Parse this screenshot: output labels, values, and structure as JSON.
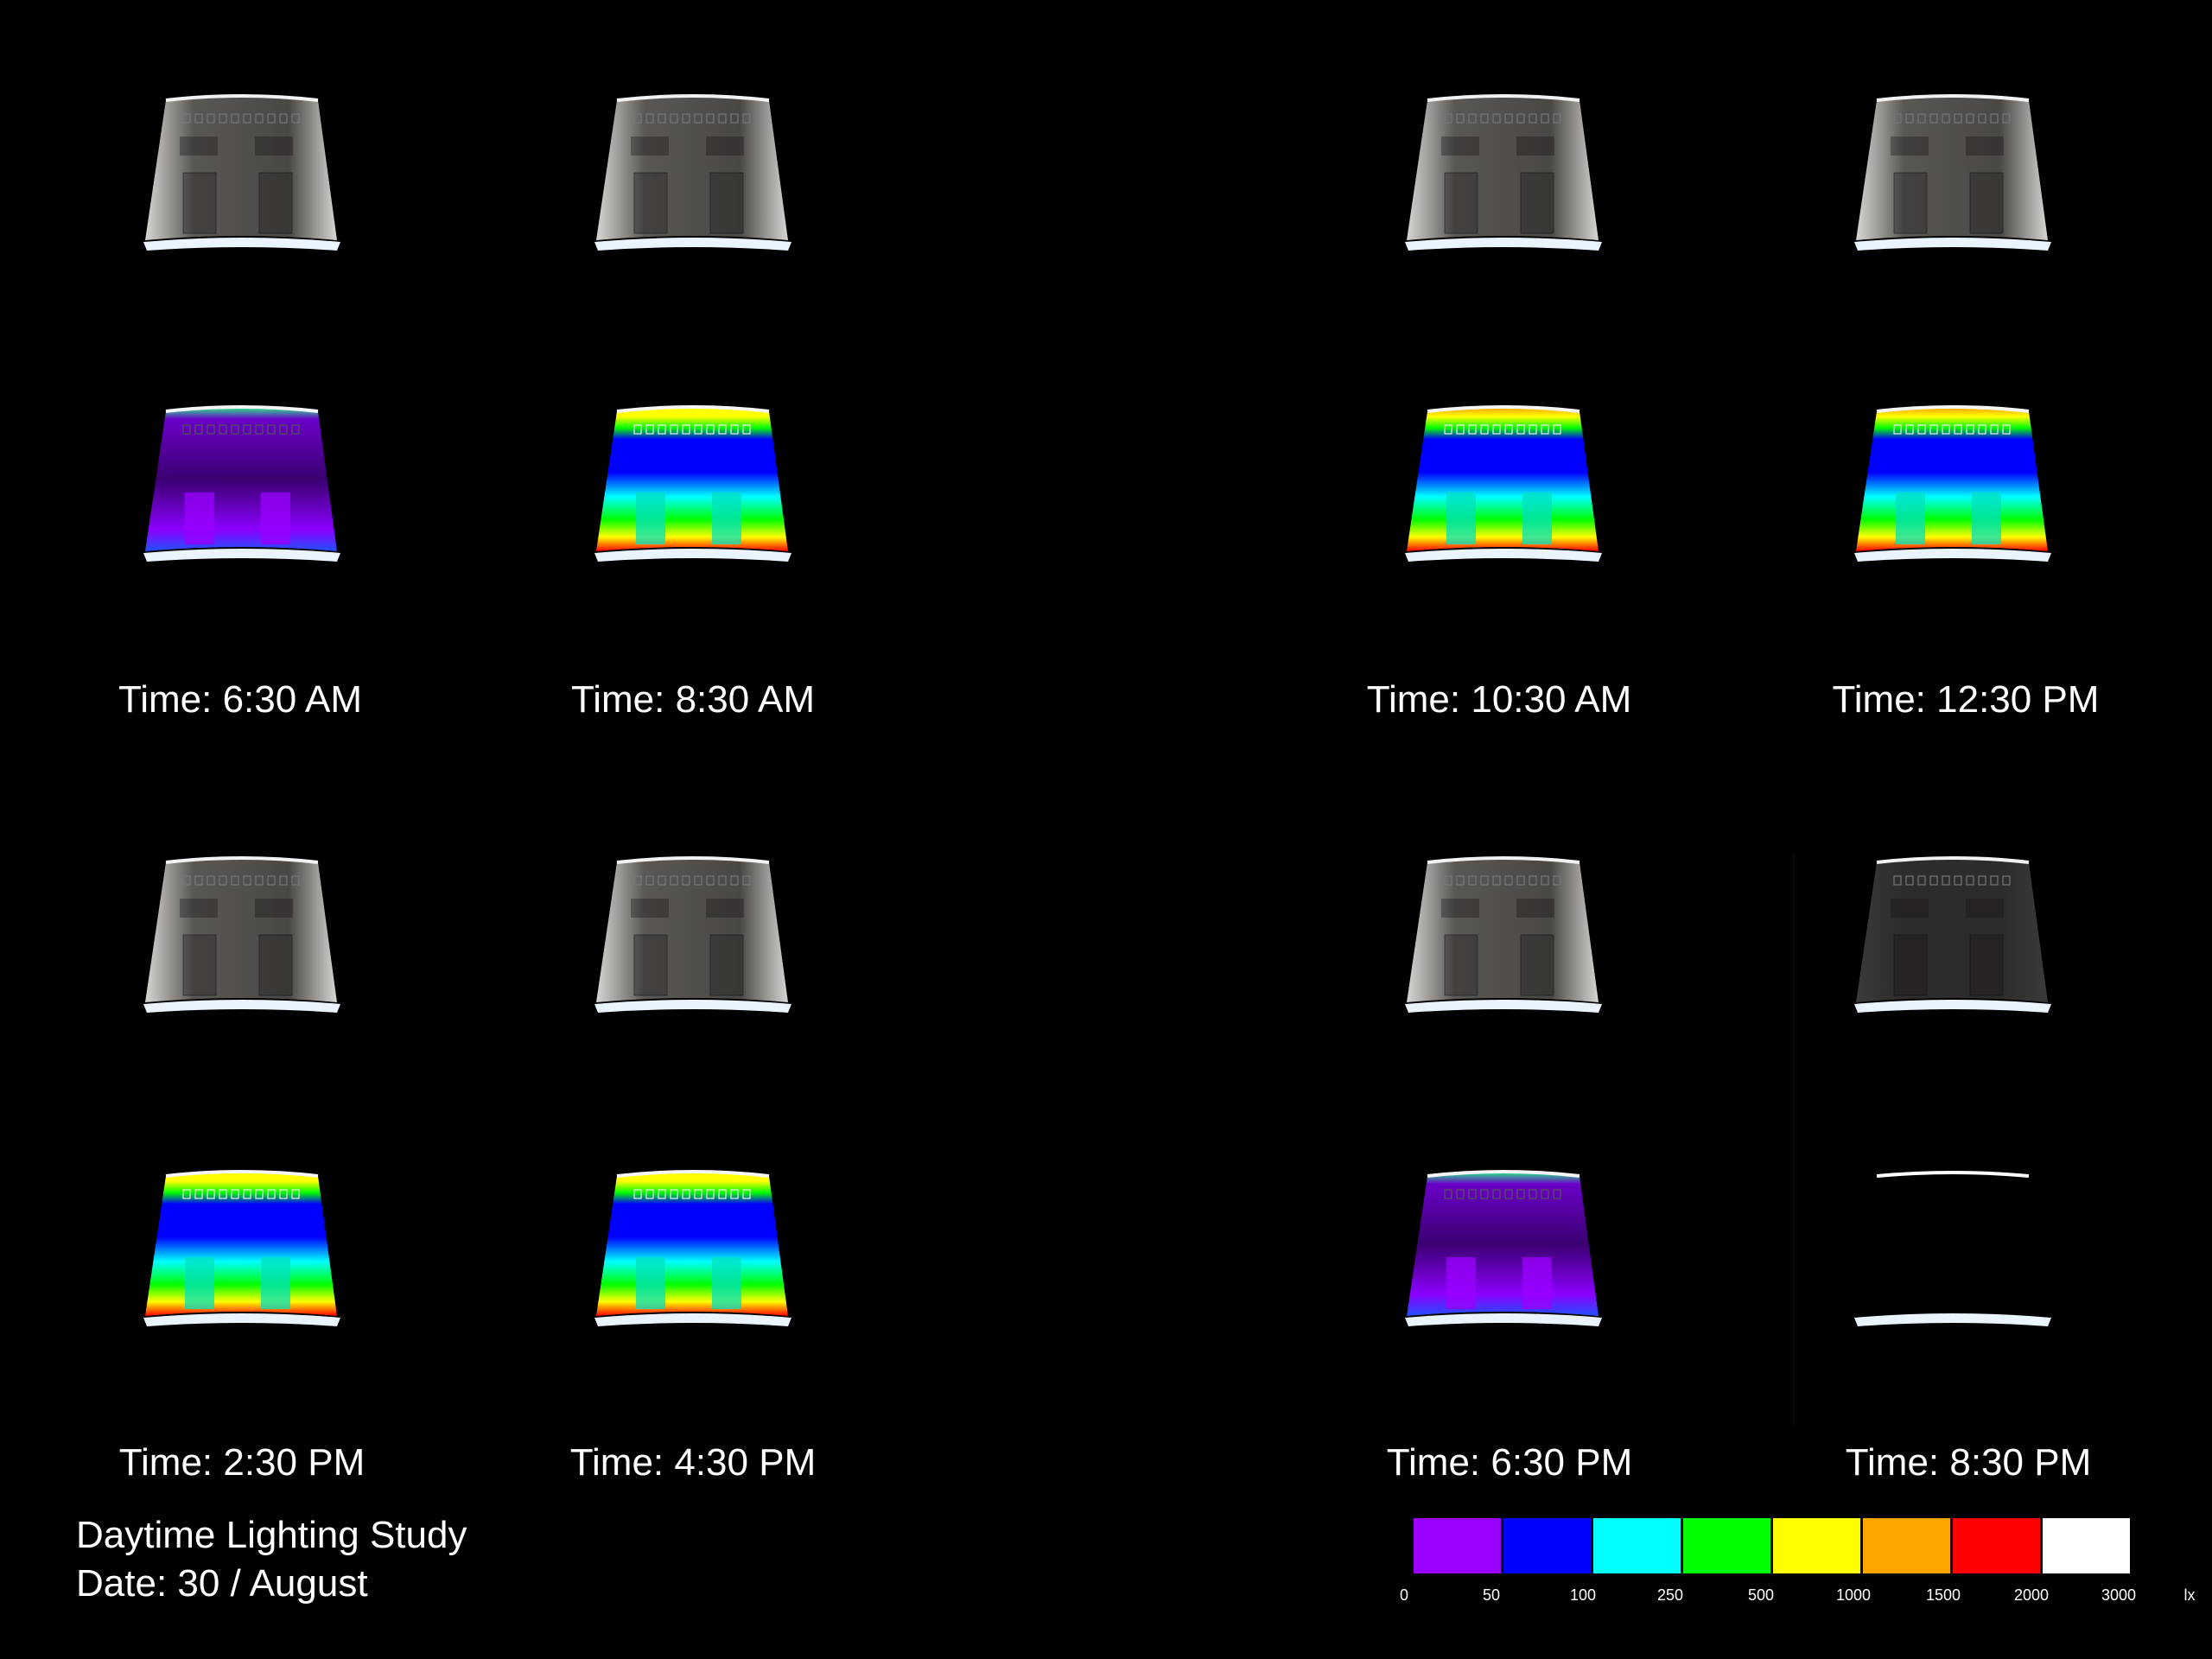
{
  "panels": [
    {
      "time": "Time: 6:30 AM",
      "level": 0.18
    },
    {
      "time": "Time: 8:30 AM",
      "level": 0.62
    },
    {
      "time": "Time: 10:30 AM",
      "level": 0.8
    },
    {
      "time": "Time: 12:30 PM",
      "level": 0.82
    },
    {
      "time": "Time: 2:30 PM",
      "level": 0.74
    },
    {
      "time": "Time: 4:30 PM",
      "level": 0.7
    },
    {
      "time": "Time: 6:30 PM",
      "level": 0.15
    },
    {
      "time": "Time: 8:30 PM",
      "level": 0.0
    }
  ],
  "caption": {
    "title": "Daytime Lighting Study",
    "date": "Date: 30 / August"
  },
  "legend": {
    "colors": [
      "#9b00ff",
      "#0000ff",
      "#00ffff",
      "#00ff00",
      "#ffff00",
      "#ffa500",
      "#ff0000",
      "#ffffff"
    ],
    "ticks": [
      "0",
      "50",
      "100",
      "250",
      "500",
      "1000",
      "1500",
      "2000",
      "3000",
      "lx"
    ]
  }
}
